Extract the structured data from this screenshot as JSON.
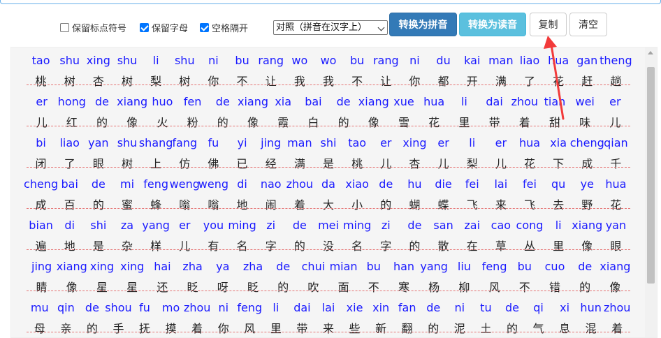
{
  "options": [
    {
      "label": "保留标点符号",
      "checked": false
    },
    {
      "label": "保留字母",
      "checked": true
    },
    {
      "label": "空格隔开",
      "checked": true
    }
  ],
  "mode_select": {
    "value": "对照（拼音在汉字上）"
  },
  "buttons": {
    "to_pinyin": "转换为拼音",
    "to_reading": "转换为读音",
    "copy": "复制",
    "clear": "清空"
  },
  "rows": [
    {
      "pinyin": [
        "tao",
        "shu",
        "xing",
        "shu",
        "li",
        "shu",
        "ni",
        "bu",
        "rang",
        "wo",
        "wo",
        "bu",
        "rang",
        "ni",
        "du",
        "kai",
        "man",
        "liao",
        "hua",
        "gan",
        "theng"
      ],
      "hanzi": [
        "桃",
        "树",
        "杏",
        "树",
        "梨",
        "树",
        "你",
        "不",
        "让",
        "我",
        "我",
        "不",
        "让",
        "你",
        "都",
        "开",
        "满",
        "了",
        "花",
        "赶",
        "趟"
      ]
    },
    {
      "pinyin": [
        "er",
        "hong",
        "de",
        "xiang",
        "huo",
        "fen",
        "de",
        "xiang",
        "xia",
        "bai",
        "de",
        "xiang",
        "xue",
        "hua",
        "li",
        "dai",
        "zhou",
        "tian",
        "wei",
        "er"
      ],
      "hanzi": [
        "儿",
        "红",
        "的",
        "像",
        "火",
        "粉",
        "的",
        "像",
        "霞",
        "白",
        "的",
        "像",
        "雪",
        "花",
        "里",
        "带",
        "着",
        "甜",
        "味",
        "儿"
      ]
    },
    {
      "pinyin": [
        "bi",
        "liao",
        "yan",
        "shu",
        "shang",
        "fang",
        "fu",
        "yi",
        "jing",
        "man",
        "shi",
        "tao",
        "er",
        "xing",
        "er",
        "li",
        "er",
        "hua",
        "xia",
        "cheng",
        "qian"
      ],
      "hanzi": [
        "闭",
        "了",
        "眼",
        "树",
        "上",
        "仿",
        "佛",
        "已",
        "经",
        "满",
        "是",
        "桃",
        "儿",
        "杏",
        "儿",
        "梨",
        "儿",
        "花",
        "下",
        "成",
        "千"
      ]
    },
    {
      "pinyin": [
        "cheng",
        "bai",
        "de",
        "mi",
        "feng",
        "weng",
        "weng",
        "di",
        "nao",
        "zhou",
        "da",
        "xiao",
        "de",
        "hu",
        "die",
        "fei",
        "lai",
        "fei",
        "qu",
        "ye",
        "hua"
      ],
      "hanzi": [
        "成",
        "百",
        "的",
        "蜜",
        "蜂",
        "嗡",
        "嗡",
        "地",
        "闹",
        "着",
        "大",
        "小",
        "的",
        "蝴",
        "蝶",
        "飞",
        "来",
        "飞",
        "去",
        "野",
        "花"
      ]
    },
    {
      "pinyin": [
        "bian",
        "di",
        "shi",
        "za",
        "yang",
        "er",
        "you",
        "ming",
        "zi",
        "de",
        "mei",
        "ming",
        "zi",
        "de",
        "san",
        "zai",
        "cao",
        "cong",
        "li",
        "xiang",
        "yan"
      ],
      "hanzi": [
        "遍",
        "地",
        "是",
        "杂",
        "样",
        "儿",
        "有",
        "名",
        "字",
        "的",
        "没",
        "名",
        "字",
        "的",
        "散",
        "在",
        "草",
        "丛",
        "里",
        "像",
        "眼"
      ]
    },
    {
      "pinyin": [
        "jing",
        "xiang",
        "xing",
        "xing",
        "hai",
        "zha",
        "ya",
        "zha",
        "de",
        "chui",
        "mian",
        "bu",
        "han",
        "yang",
        "liu",
        "feng",
        "bu",
        "cuo",
        "de",
        "xiang"
      ],
      "hanzi": [
        "睛",
        "像",
        "星",
        "星",
        "还",
        "眨",
        "呀",
        "眨",
        "的",
        "吹",
        "面",
        "不",
        "寒",
        "杨",
        "柳",
        "风",
        "不",
        "错",
        "的",
        "像"
      ]
    },
    {
      "pinyin": [
        "mu",
        "qin",
        "de",
        "shou",
        "fu",
        "mo",
        "zhou",
        "ni",
        "feng",
        "li",
        "dai",
        "lai",
        "xie",
        "xin",
        "fan",
        "de",
        "ni",
        "tu",
        "de",
        "qi",
        "xi",
        "hun",
        "zhou"
      ],
      "hanzi": [
        "母",
        "亲",
        "的",
        "手",
        "抚",
        "摸",
        "着",
        "你",
        "风",
        "里",
        "带",
        "来",
        "些",
        "新",
        "翻",
        "的",
        "泥",
        "土",
        "的",
        "气",
        "息",
        "混",
        "着"
      ]
    }
  ]
}
